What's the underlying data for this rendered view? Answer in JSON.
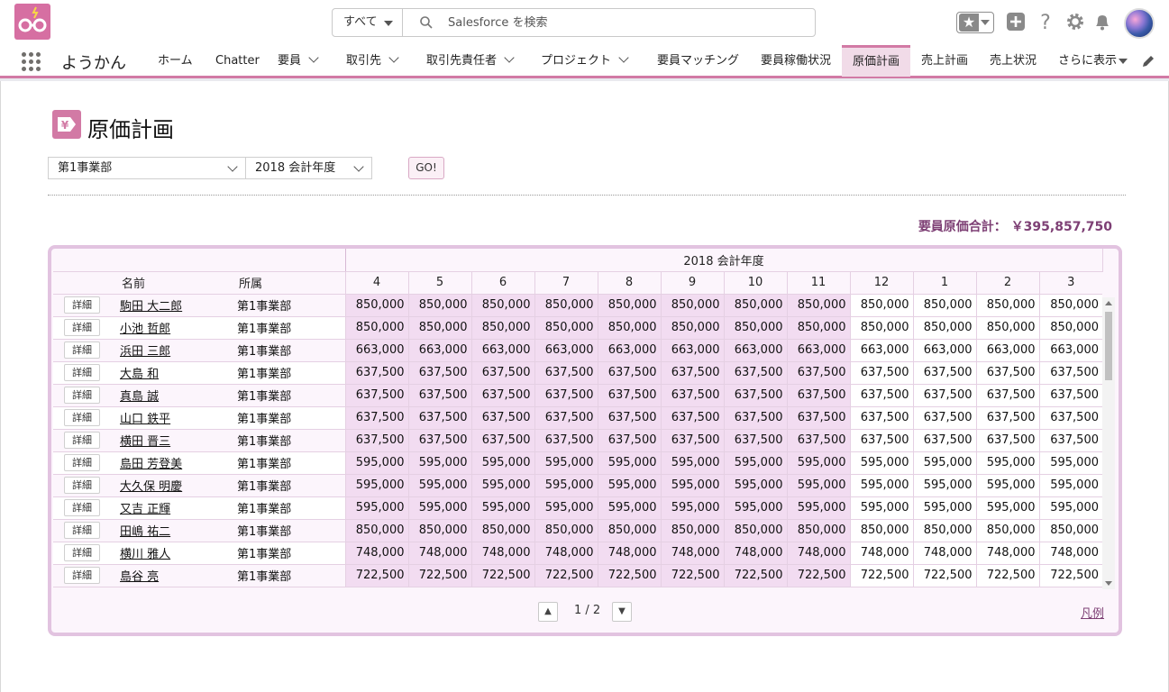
{
  "header": {
    "search_scope": "すべて",
    "search_placeholder": "Salesforce を検索"
  },
  "nav": {
    "app_name": "ようかん",
    "tabs": [
      {
        "label": "ホーム"
      },
      {
        "label": "Chatter"
      },
      {
        "label": "要員"
      },
      {
        "label": "取引先"
      },
      {
        "label": "取引先責任者"
      },
      {
        "label": "プロジェクト"
      },
      {
        "label": "要員マッチング"
      },
      {
        "label": "要員稼働状況"
      },
      {
        "label": "原価計画"
      },
      {
        "label": "売上計画"
      },
      {
        "label": "売上状況"
      },
      {
        "label": "さらに表示"
      }
    ]
  },
  "page": {
    "title": "原価計画",
    "division_select": "第1事業部",
    "year_select": "2018 会計年度",
    "go_label": "GO!",
    "total_label": "要員原価合計：",
    "total_value": "￥395,857,750"
  },
  "grid": {
    "fiscal_year_header": "2018 会計年度",
    "col_name": "名前",
    "col_dept": "所属",
    "months": [
      "4",
      "5",
      "6",
      "7",
      "8",
      "9",
      "10",
      "11",
      "12",
      "1",
      "2",
      "3"
    ],
    "detail_label": "詳細",
    "rows": [
      {
        "name": "駒田 大二郎",
        "dept": "第1事業部",
        "values": [
          "850,000",
          "850,000",
          "850,000",
          "850,000",
          "850,000",
          "850,000",
          "850,000",
          "850,000",
          "850,000",
          "850,000",
          "850,000",
          "850,000"
        ]
      },
      {
        "name": "小池 哲郎",
        "dept": "第1事業部",
        "values": [
          "850,000",
          "850,000",
          "850,000",
          "850,000",
          "850,000",
          "850,000",
          "850,000",
          "850,000",
          "850,000",
          "850,000",
          "850,000",
          "850,000"
        ]
      },
      {
        "name": "浜田 三郎",
        "dept": "第1事業部",
        "values": [
          "663,000",
          "663,000",
          "663,000",
          "663,000",
          "663,000",
          "663,000",
          "663,000",
          "663,000",
          "663,000",
          "663,000",
          "663,000",
          "663,000"
        ]
      },
      {
        "name": "大島 和",
        "dept": "第1事業部",
        "values": [
          "637,500",
          "637,500",
          "637,500",
          "637,500",
          "637,500",
          "637,500",
          "637,500",
          "637,500",
          "637,500",
          "637,500",
          "637,500",
          "637,500"
        ]
      },
      {
        "name": "真島 誠",
        "dept": "第1事業部",
        "values": [
          "637,500",
          "637,500",
          "637,500",
          "637,500",
          "637,500",
          "637,500",
          "637,500",
          "637,500",
          "637,500",
          "637,500",
          "637,500",
          "637,500"
        ]
      },
      {
        "name": "山口 鉄平",
        "dept": "第1事業部",
        "values": [
          "637,500",
          "637,500",
          "637,500",
          "637,500",
          "637,500",
          "637,500",
          "637,500",
          "637,500",
          "637,500",
          "637,500",
          "637,500",
          "637,500"
        ]
      },
      {
        "name": "横田 晋三",
        "dept": "第1事業部",
        "values": [
          "637,500",
          "637,500",
          "637,500",
          "637,500",
          "637,500",
          "637,500",
          "637,500",
          "637,500",
          "637,500",
          "637,500",
          "637,500",
          "637,500"
        ]
      },
      {
        "name": "島田 芳登美",
        "dept": "第1事業部",
        "values": [
          "595,000",
          "595,000",
          "595,000",
          "595,000",
          "595,000",
          "595,000",
          "595,000",
          "595,000",
          "595,000",
          "595,000",
          "595,000",
          "595,000"
        ]
      },
      {
        "name": "大久保 明慶",
        "dept": "第1事業部",
        "values": [
          "595,000",
          "595,000",
          "595,000",
          "595,000",
          "595,000",
          "595,000",
          "595,000",
          "595,000",
          "595,000",
          "595,000",
          "595,000",
          "595,000"
        ]
      },
      {
        "name": "又吉 正輝",
        "dept": "第1事業部",
        "values": [
          "595,000",
          "595,000",
          "595,000",
          "595,000",
          "595,000",
          "595,000",
          "595,000",
          "595,000",
          "595,000",
          "595,000",
          "595,000",
          "595,000"
        ]
      },
      {
        "name": "田嶋 祐二",
        "dept": "第1事業部",
        "values": [
          "850,000",
          "850,000",
          "850,000",
          "850,000",
          "850,000",
          "850,000",
          "850,000",
          "850,000",
          "850,000",
          "850,000",
          "850,000",
          "850,000"
        ]
      },
      {
        "name": "横川 雅人",
        "dept": "第1事業部",
        "values": [
          "748,000",
          "748,000",
          "748,000",
          "748,000",
          "748,000",
          "748,000",
          "748,000",
          "748,000",
          "748,000",
          "748,000",
          "748,000",
          "748,000"
        ]
      },
      {
        "name": "島谷 亮",
        "dept": "第1事業部",
        "values": [
          "722,500",
          "722,500",
          "722,500",
          "722,500",
          "722,500",
          "722,500",
          "722,500",
          "722,500",
          "722,500",
          "722,500",
          "722,500",
          "722,500"
        ]
      }
    ],
    "pager_text": "1 / 2",
    "legend_label": "凡例"
  },
  "colors": {
    "brand": "#d66fa2",
    "accent": "#d27aa5",
    "total_text": "#7d3f74",
    "actual_cell": "#f2dcf1"
  }
}
